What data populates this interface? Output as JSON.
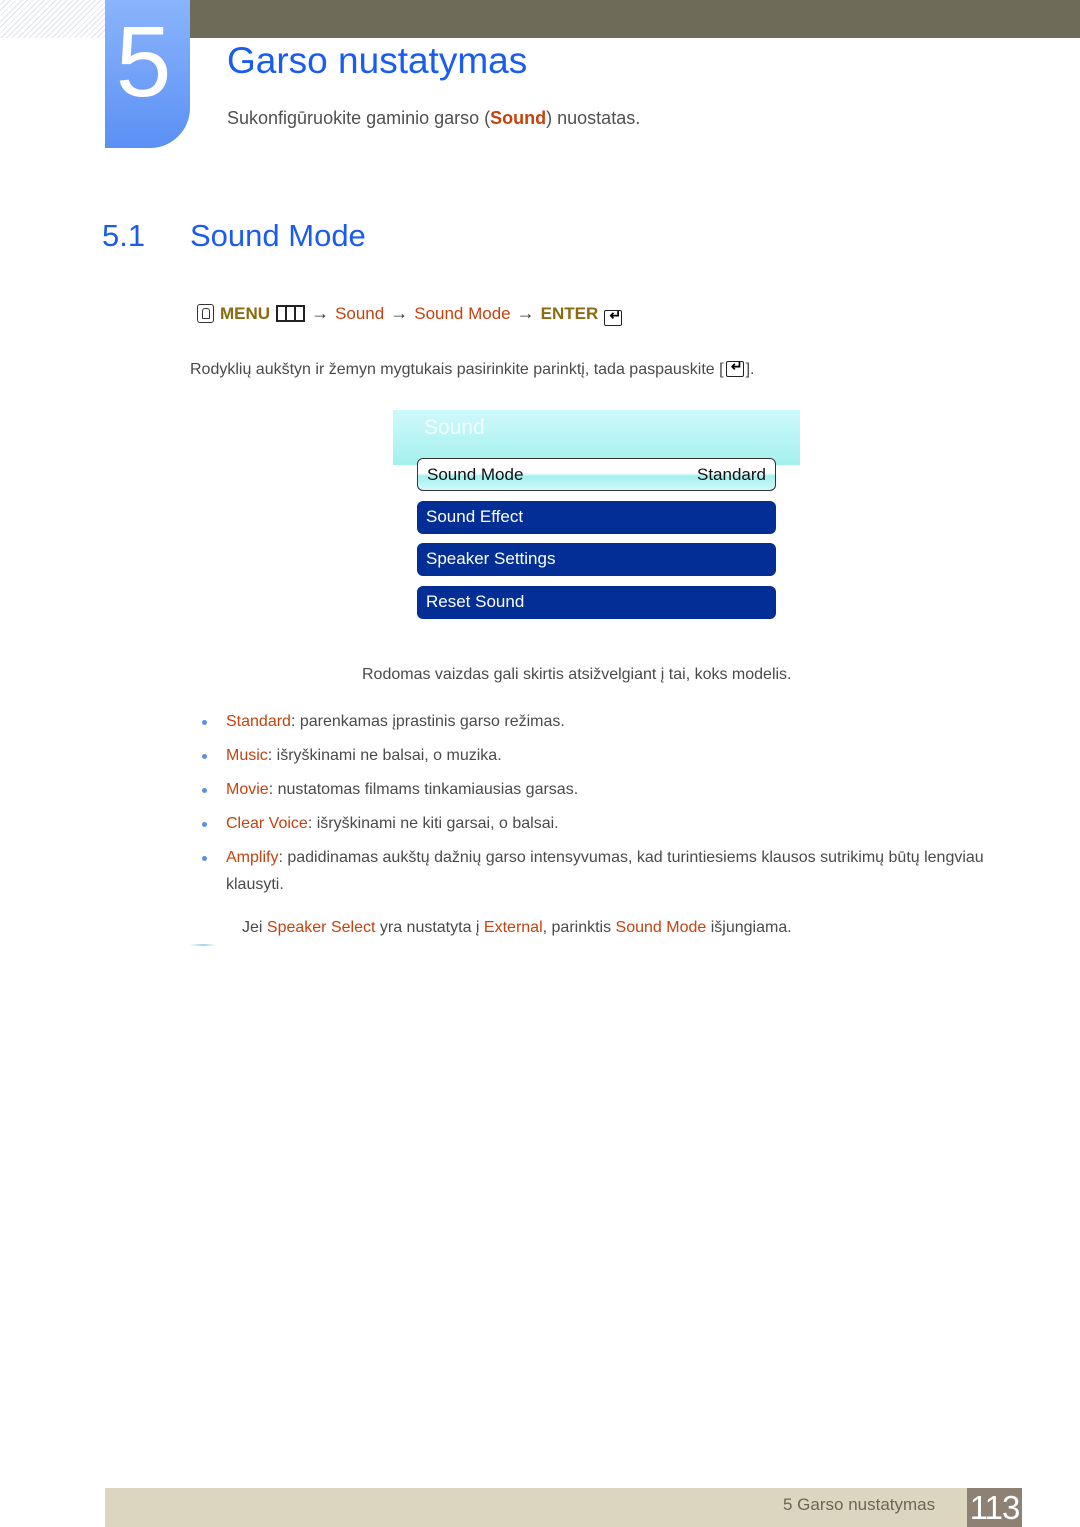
{
  "chapter": {
    "number": "5",
    "title": "Garso nustatymas",
    "subtitle_pre": "Sukonfigūruokite gaminio garso (",
    "subtitle_accent": "Sound",
    "subtitle_post": ") nuostatas."
  },
  "section": {
    "number": "5.1",
    "title": "Sound Mode"
  },
  "menu_path": {
    "menu": "MENU",
    "steps": [
      "Sound",
      "Sound Mode"
    ],
    "enter": "ENTER",
    "arrow": "→"
  },
  "instruction": {
    "text": "Rodyklių aukštyn ir žemyn mygtukais pasirinkite parinktį, tada paspauskite [",
    "close": "]."
  },
  "osd": {
    "title": "Sound",
    "items": [
      {
        "label": "Sound Mode",
        "value": "Standard",
        "selected": true
      },
      {
        "label": "Sound Effect"
      },
      {
        "label": "Speaker Settings"
      },
      {
        "label": "Reset Sound"
      }
    ],
    "colors": {
      "item_bg": "#032e96",
      "header_bg": "#a4f0ee"
    }
  },
  "note_center": "Rodomas vaizdas gali skirtis atsižvelgiant į tai, koks modelis.",
  "bullets": [
    {
      "term": "Standard",
      "desc": ": parenkamas įprastinis garso režimas."
    },
    {
      "term": "Music",
      "desc": ": išryškinami ne balsai, o muzika."
    },
    {
      "term": "Movie",
      "desc": ": nustatomas filmams tinkamiausias garsas."
    },
    {
      "term": "Clear Voice",
      "desc": ": išryškinami ne kiti garsai, o balsai."
    },
    {
      "term": "Amplify",
      "desc": ": padidinamas aukštų dažnių garso intensyvumas, kad turintiesiems klausos sutrikimų būtų lengviau klausyti."
    }
  ],
  "note": {
    "p1": "Jei ",
    "a1": "Speaker Select",
    "p2": " yra nustatyta į ",
    "a2": "External",
    "p3": ", parinktis ",
    "a3": "Sound Mode",
    "p4": " išjungiama."
  },
  "footer": {
    "text": "5 Garso nustatymas",
    "page": "113"
  },
  "colors": {
    "heading_blue": "#1a5cf0",
    "accent_orange": "#c6420e",
    "menu_gold": "#8b6a10",
    "top_bar": "#6e6b58",
    "footer_bar": "#dcd6c1",
    "page_box": "#8d8174"
  }
}
